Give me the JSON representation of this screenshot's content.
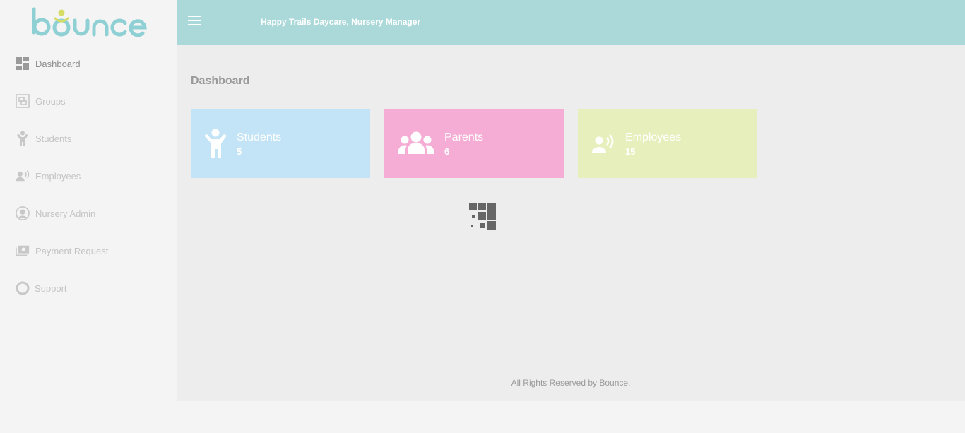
{
  "brand": {
    "logo_text": "bounce"
  },
  "colors": {
    "topbar": "#abd9da",
    "students_card": "#c3e3f6",
    "parents_card": "#f5add6",
    "employees_card": "#e7f0bd"
  },
  "header": {
    "title": "Happy Trails Daycare, Nursery Manager",
    "menu_icon": "hamburger-icon"
  },
  "sidebar": {
    "items": [
      {
        "label": "Dashboard",
        "icon": "dashboard-icon",
        "active": true
      },
      {
        "label": "Groups",
        "icon": "groups-icon"
      },
      {
        "label": "Students",
        "icon": "child-icon"
      },
      {
        "label": "Employees",
        "icon": "employee-icon"
      },
      {
        "label": "Nursery Admin",
        "icon": "user-circle-icon"
      },
      {
        "label": "Payment Request",
        "icon": "money-icon"
      },
      {
        "label": "Support",
        "icon": "lifebuoy-icon"
      }
    ]
  },
  "main": {
    "page_title": "Dashboard",
    "cards": [
      {
        "label": "Students",
        "count": "5",
        "icon": "child-icon"
      },
      {
        "label": "Parents",
        "count": "6",
        "icon": "users-icon"
      },
      {
        "label": "Employees",
        "count": "15",
        "icon": "employee-icon"
      }
    ],
    "loader_icon": "loading-spinner-icon"
  },
  "footer": {
    "text": "All Rights Reserved by Bounce."
  }
}
